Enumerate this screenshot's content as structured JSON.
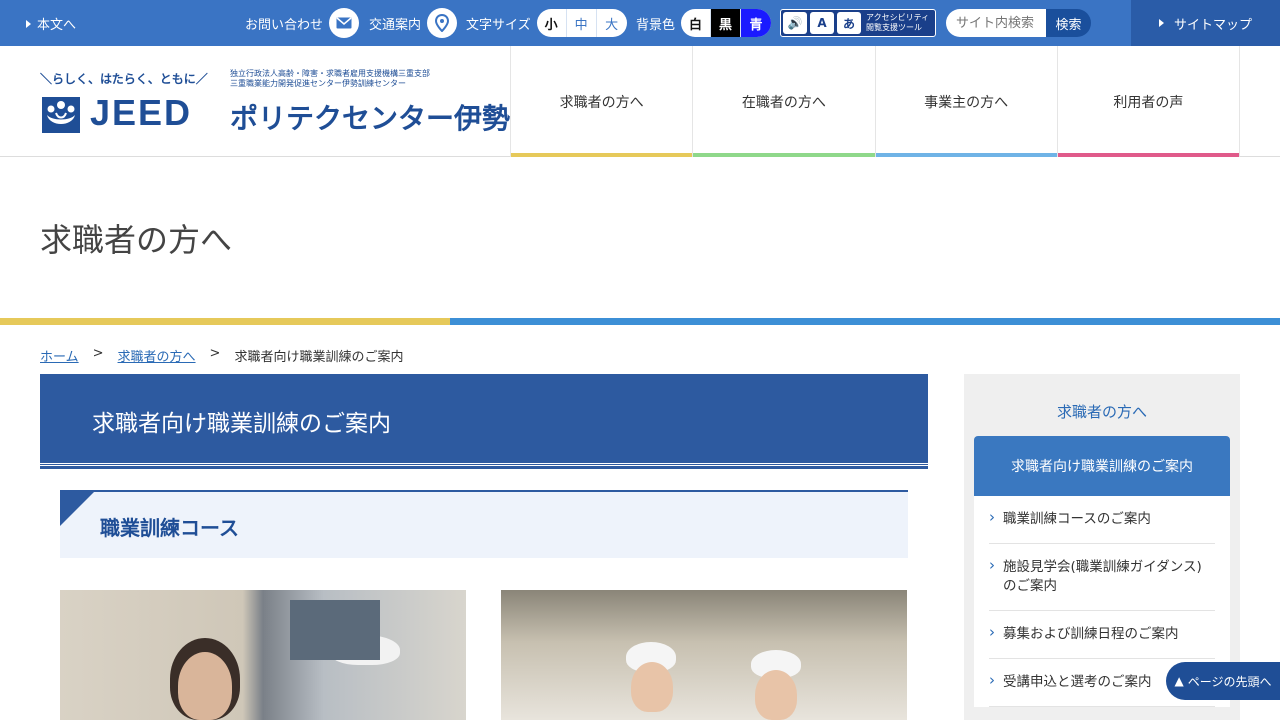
{
  "topbar": {
    "skip_link": "本文へ",
    "contact": "お問い合わせ",
    "access": "交通案内",
    "font_size_label": "文字サイズ",
    "font_sizes": [
      "小",
      "中",
      "大"
    ],
    "bg_label": "背景色",
    "bg_colors": [
      "白",
      "黒",
      "青"
    ],
    "acc_tool_label": "アクセシビリティ\n閲覧支援ツール",
    "search_placeholder": "サイト内検索",
    "search_button": "検索",
    "sitemap": "サイトマップ"
  },
  "header": {
    "slogan": "＼らしく、はたらく、ともに／",
    "logo": "JEED",
    "org_line1": "独立行政法人高齢・障害・求職者雇用支援機構三重支部",
    "org_line2": "三重職業能力開発促進センター伊勢訓練センター",
    "center_name": "ポリテクセンター伊勢"
  },
  "gnav": [
    {
      "label": "求職者の方へ",
      "color": "#e6c95a"
    },
    {
      "label": "在職者の方へ",
      "color": "#8fd88a"
    },
    {
      "label": "事業主の方へ",
      "color": "#6fb3e6"
    },
    {
      "label": "利用者の声",
      "color": "#e05a8a"
    }
  ],
  "page_title": "求職者の方へ",
  "breadcrumb": {
    "home": "ホーム",
    "sep": ">",
    "parent": "求職者の方へ",
    "current": "求職者向け職業訓練のご案内"
  },
  "main": {
    "heading": "求職者向け職業訓練のご案内",
    "section_heading": "職業訓練コース"
  },
  "sidebar": {
    "title": "求職者の方へ",
    "active": "求職者向け職業訓練のご案内",
    "items": [
      "職業訓練コースのご案内",
      "施設見学会(職業訓練ガイダンス)のご案内",
      "募集および訓練日程のご案内",
      "受講申込と選考のご案内"
    ]
  },
  "pagetop": "ページの先頭へ"
}
